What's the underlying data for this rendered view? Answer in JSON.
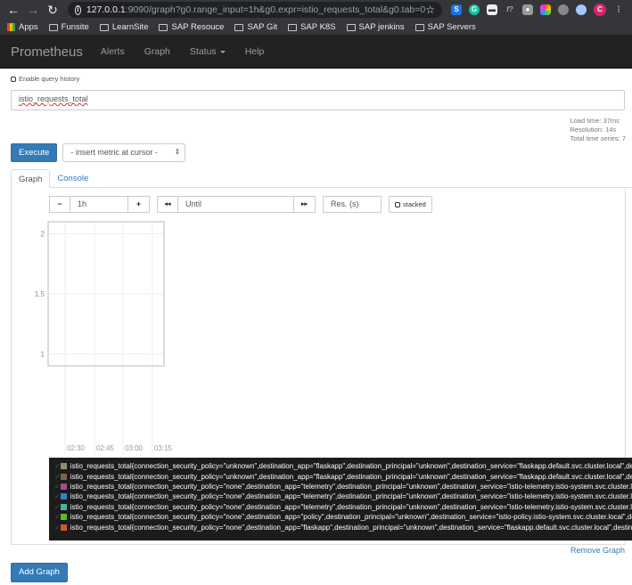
{
  "browser": {
    "url_host": "127.0.0.1",
    "url_rest": ":9090/graph?g0.range_input=1h&g0.expr=istio_requests_total&g0.tab=0",
    "bookmarks": [
      "Apps",
      "Funsite",
      "LearnSite",
      "SAP Resouce",
      "SAP Git",
      "SAP K8S",
      "SAP jenkins",
      "SAP Servers"
    ],
    "profile_initial": "C"
  },
  "navbar": {
    "brand": "Prometheus",
    "links": [
      "Alerts",
      "Graph",
      "Status",
      "Help"
    ]
  },
  "query": {
    "history_label": "Enable query history",
    "expression": "istio_requests_total",
    "stats": [
      "Load time: 37ms",
      "Resolution: 14s",
      "Total time series: 7"
    ],
    "execute_label": "Execute",
    "metric_select": "- insert metric at cursor -"
  },
  "tabs": [
    "Graph",
    "Console"
  ],
  "controls": {
    "minus": "−",
    "range": "1h",
    "plus": "+",
    "back": "◂◂",
    "until_placeholder": "Until",
    "forward": "▸▸",
    "res_placeholder": "Res. (s)",
    "stacked_label": "stacked"
  },
  "chart_data": {
    "type": "line",
    "title": "",
    "xlabel": "",
    "ylabel": "",
    "y_ticks": [
      "2",
      "1.5",
      "1"
    ],
    "ylim": [
      0.9,
      2.1
    ],
    "x_ticks": [
      "02:30",
      "02:45",
      "03:00",
      "03:15"
    ],
    "grid": true,
    "series": []
  },
  "legend": [
    {
      "color": "#8e8e78",
      "label": "istio_requests_total{connection_security_policy=\"unknown\",destination_app=\"flaskapp\",destination_principal=\"unknown\",destination_service=\"flaskapp.default.svc.cluster.local\",destin"
    },
    {
      "color": "#7b6547",
      "label": "istio_requests_total{connection_security_policy=\"unknown\",destination_app=\"flaskapp\",destination_principal=\"unknown\",destination_service=\"flaskapp.default.svc.cluster.local\",destin"
    },
    {
      "color": "#9b4f8f",
      "label": "istio_requests_total{connection_security_policy=\"none\",destination_app=\"telemetry\",destination_principal=\"unknown\",destination_service=\"istio-telemetry.istio-system.svc.cluster.local"
    },
    {
      "color": "#3a7ec3",
      "label": "istio_requests_total{connection_security_policy=\"none\",destination_app=\"telemetry\",destination_principal=\"unknown\",destination_service=\"istio-telemetry.istio-system.svc.cluster.local"
    },
    {
      "color": "#4cb0a3",
      "label": "istio_requests_total{connection_security_policy=\"none\",destination_app=\"telemetry\",destination_principal=\"unknown\",destination_service=\"istio-telemetry.istio-system.svc.cluster.local"
    },
    {
      "color": "#5bb82e",
      "label": "istio_requests_total{connection_security_policy=\"none\",destination_app=\"policy\",destination_principal=\"unknown\",destination_service=\"istio-policy.istio-system.svc.cluster.local\",destin"
    },
    {
      "color": "#d4523a",
      "label": "istio_requests_total{connection_security_policy=\"none\",destination_app=\"flaskapp\",destination_principal=\"unknown\",destination_service=\"flaskapp.default.svc.cluster.local\",destinatio"
    }
  ],
  "remove_graph": "Remove Graph",
  "add_graph": "Add Graph"
}
